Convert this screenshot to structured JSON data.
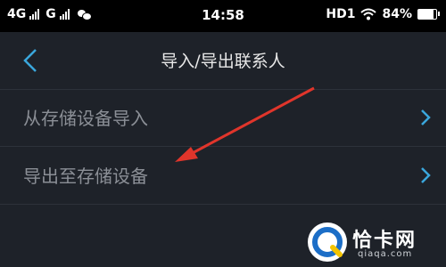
{
  "status_bar": {
    "network_1": "4G",
    "network_2": "G",
    "time": "14:58",
    "hd": "HD1",
    "battery_text": "84%",
    "battery_level": 0.84
  },
  "header": {
    "title": "导入/导出联系人"
  },
  "menu": {
    "items": [
      {
        "label": "从存储设备导入"
      },
      {
        "label": "导出至存储设备"
      }
    ]
  },
  "watermark": {
    "brand": "恰卡网",
    "url": "qiaqa.com"
  },
  "colors": {
    "accent": "#3aa7dc",
    "annotation": "#e0352b",
    "background": "#1e2229"
  }
}
